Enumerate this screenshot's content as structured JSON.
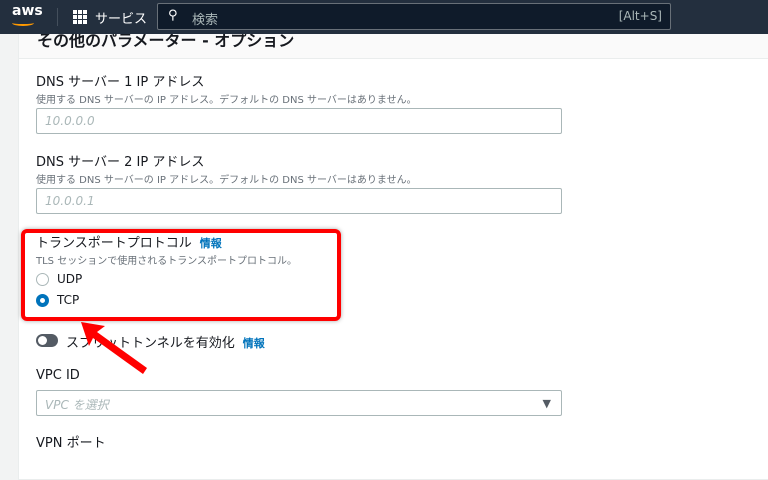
{
  "nav": {
    "logo": "aws",
    "services": "サービス",
    "search_placeholder": "検索",
    "shortcut": "[Alt+S]"
  },
  "section": {
    "title": "その他のパラメーター - オプション"
  },
  "dns1": {
    "label": "DNS サーバー 1 IP アドレス",
    "desc": "使用する DNS サーバーの IP アドレス。デフォルトの DNS サーバーはありません。",
    "placeholder": "10.0.0.0"
  },
  "dns2": {
    "label": "DNS サーバー 2 IP アドレス",
    "desc": "使用する DNS サーバーの IP アドレス。デフォルトの DNS サーバーはありません。",
    "placeholder": "10.0.0.1"
  },
  "transport": {
    "label": "トランスポートプロトコル",
    "info": "情報",
    "desc": "TLS セッションで使用されるトランスポートプロトコル。",
    "options": [
      "UDP",
      "TCP"
    ],
    "selected": "TCP"
  },
  "split": {
    "label": "スプリットトンネルを有効化",
    "info": "情報",
    "enabled": false
  },
  "vpc": {
    "label": "VPC ID",
    "placeholder": "VPC を選択"
  },
  "vpn_port": {
    "label": "VPN ポート"
  },
  "colors": {
    "highlight": "#ff0000",
    "accent": "#0073bb"
  }
}
